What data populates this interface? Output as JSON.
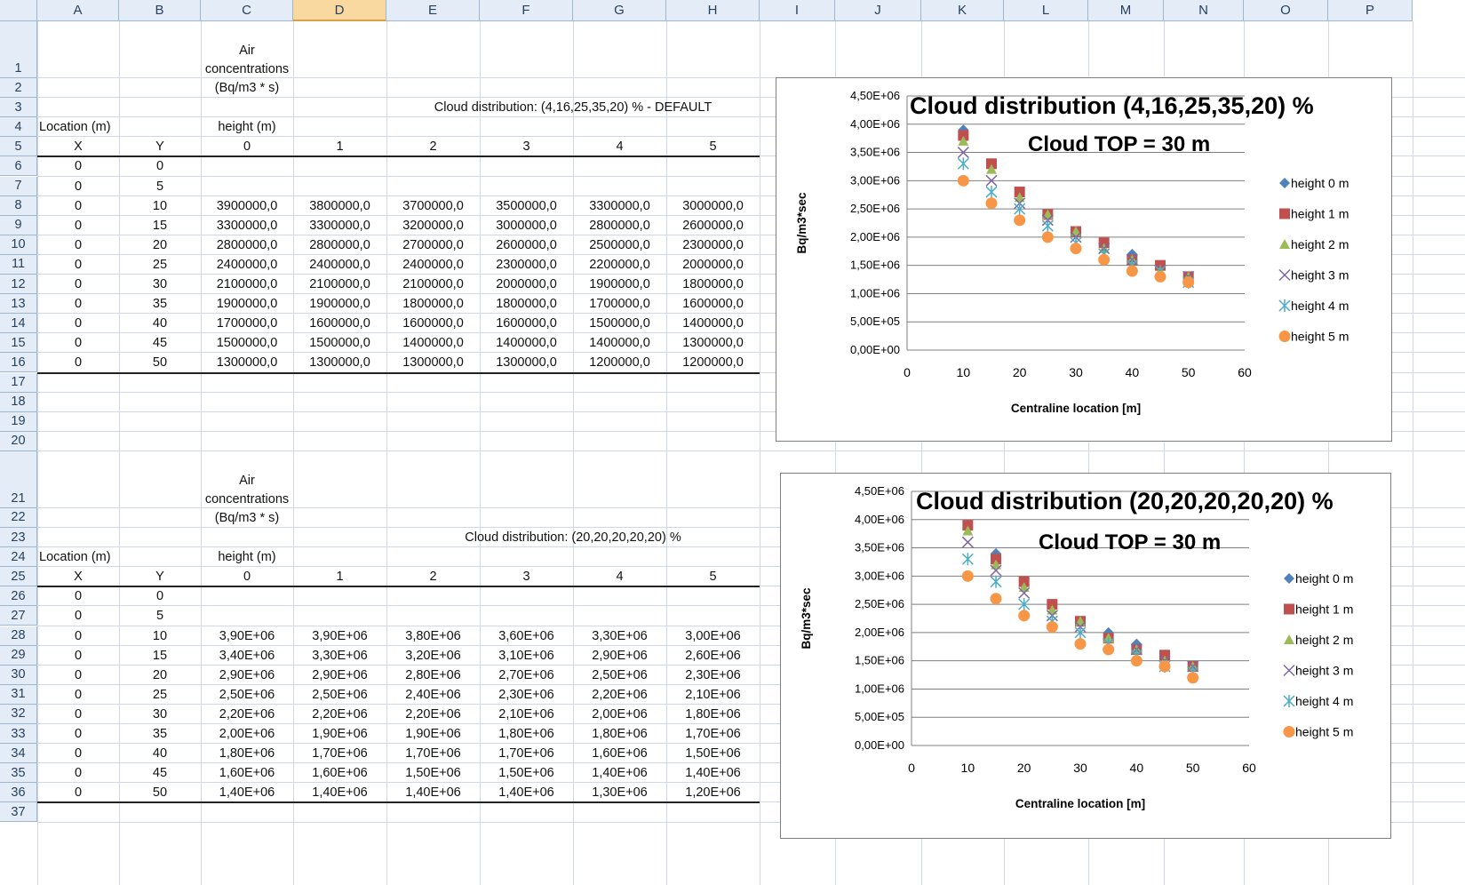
{
  "columns": [
    "A",
    "B",
    "C",
    "D",
    "E",
    "F",
    "G",
    "H",
    "I",
    "J",
    "K",
    "L",
    "M",
    "N",
    "O",
    "P"
  ],
  "selected_column": "D",
  "table1": {
    "header_label": "Air concentrations (Bq/m3 * s)",
    "title": "Cloud distribution:  (4,16,25,35,20) % - DEFAULT",
    "location_label": "Location (m)",
    "height_label": "height (m)",
    "x_label": "X",
    "y_label": "Y",
    "heights": [
      "0",
      "1",
      "2",
      "3",
      "4",
      "5"
    ],
    "rows": [
      {
        "x": "0",
        "y": "0",
        "vals": []
      },
      {
        "x": "0",
        "y": "5",
        "vals": []
      },
      {
        "x": "0",
        "y": "10",
        "vals": [
          "3900000,0",
          "3800000,0",
          "3700000,0",
          "3500000,0",
          "3300000,0",
          "3000000,0"
        ]
      },
      {
        "x": "0",
        "y": "15",
        "vals": [
          "3300000,0",
          "3300000,0",
          "3200000,0",
          "3000000,0",
          "2800000,0",
          "2600000,0"
        ]
      },
      {
        "x": "0",
        "y": "20",
        "vals": [
          "2800000,0",
          "2800000,0",
          "2700000,0",
          "2600000,0",
          "2500000,0",
          "2300000,0"
        ]
      },
      {
        "x": "0",
        "y": "25",
        "vals": [
          "2400000,0",
          "2400000,0",
          "2400000,0",
          "2300000,0",
          "2200000,0",
          "2000000,0"
        ]
      },
      {
        "x": "0",
        "y": "30",
        "vals": [
          "2100000,0",
          "2100000,0",
          "2100000,0",
          "2000000,0",
          "1900000,0",
          "1800000,0"
        ]
      },
      {
        "x": "0",
        "y": "35",
        "vals": [
          "1900000,0",
          "1900000,0",
          "1800000,0",
          "1800000,0",
          "1700000,0",
          "1600000,0"
        ]
      },
      {
        "x": "0",
        "y": "40",
        "vals": [
          "1700000,0",
          "1600000,0",
          "1600000,0",
          "1600000,0",
          "1500000,0",
          "1400000,0"
        ]
      },
      {
        "x": "0",
        "y": "45",
        "vals": [
          "1500000,0",
          "1500000,0",
          "1400000,0",
          "1400000,0",
          "1400000,0",
          "1300000,0"
        ]
      },
      {
        "x": "0",
        "y": "50",
        "vals": [
          "1300000,0",
          "1300000,0",
          "1300000,0",
          "1300000,0",
          "1200000,0",
          "1200000,0"
        ]
      }
    ]
  },
  "table2": {
    "header_label": "Air concentrations (Bq/m3 * s)",
    "title": "Cloud distribution:  (20,20,20,20,20) %",
    "location_label": "Location (m)",
    "height_label": "height (m)",
    "x_label": "X",
    "y_label": "Y",
    "heights": [
      "0",
      "1",
      "2",
      "3",
      "4",
      "5"
    ],
    "rows": [
      {
        "x": "0",
        "y": "0",
        "vals": []
      },
      {
        "x": "0",
        "y": "5",
        "vals": []
      },
      {
        "x": "0",
        "y": "10",
        "vals": [
          "3,90E+06",
          "3,90E+06",
          "3,80E+06",
          "3,60E+06",
          "3,30E+06",
          "3,00E+06"
        ]
      },
      {
        "x": "0",
        "y": "15",
        "vals": [
          "3,40E+06",
          "3,30E+06",
          "3,20E+06",
          "3,10E+06",
          "2,90E+06",
          "2,60E+06"
        ]
      },
      {
        "x": "0",
        "y": "20",
        "vals": [
          "2,90E+06",
          "2,90E+06",
          "2,80E+06",
          "2,70E+06",
          "2,50E+06",
          "2,30E+06"
        ]
      },
      {
        "x": "0",
        "y": "25",
        "vals": [
          "2,50E+06",
          "2,50E+06",
          "2,40E+06",
          "2,30E+06",
          "2,20E+06",
          "2,10E+06"
        ]
      },
      {
        "x": "0",
        "y": "30",
        "vals": [
          "2,20E+06",
          "2,20E+06",
          "2,20E+06",
          "2,10E+06",
          "2,00E+06",
          "1,80E+06"
        ]
      },
      {
        "x": "0",
        "y": "35",
        "vals": [
          "2,00E+06",
          "1,90E+06",
          "1,90E+06",
          "1,80E+06",
          "1,80E+06",
          "1,70E+06"
        ]
      },
      {
        "x": "0",
        "y": "40",
        "vals": [
          "1,80E+06",
          "1,70E+06",
          "1,70E+06",
          "1,70E+06",
          "1,60E+06",
          "1,50E+06"
        ]
      },
      {
        "x": "0",
        "y": "45",
        "vals": [
          "1,60E+06",
          "1,60E+06",
          "1,50E+06",
          "1,50E+06",
          "1,40E+06",
          "1,40E+06"
        ]
      },
      {
        "x": "0",
        "y": "50",
        "vals": [
          "1,40E+06",
          "1,40E+06",
          "1,40E+06",
          "1,40E+06",
          "1,30E+06",
          "1,20E+06"
        ]
      }
    ]
  },
  "chart_data": [
    {
      "type": "scatter",
      "title": "Cloud distribution (4,16,25,35,20) %",
      "subtitle": "Cloud TOP = 30 m",
      "xlabel": "Centraline location  [m]",
      "ylabel": "Bq/m3*sec",
      "xlim": [
        0,
        60
      ],
      "ylim": [
        0,
        4500000
      ],
      "x_ticks": [
        "0",
        "10",
        "20",
        "30",
        "40",
        "50",
        "60"
      ],
      "y_ticks": [
        "0,00E+00",
        "5,00E+05",
        "1,00E+06",
        "1,50E+06",
        "2,00E+06",
        "2,50E+06",
        "3,00E+06",
        "3,50E+06",
        "4,00E+06",
        "4,50E+06"
      ],
      "grid": true,
      "legend_position": "right",
      "x": [
        10,
        15,
        20,
        25,
        30,
        35,
        40,
        45,
        50
      ],
      "series": [
        {
          "name": "height 0 m",
          "color": "#4f81bd",
          "marker": "diamond",
          "values": [
            3900000,
            3300000,
            2800000,
            2400000,
            2100000,
            1900000,
            1700000,
            1500000,
            1300000
          ]
        },
        {
          "name": "height 1 m",
          "color": "#c0504d",
          "marker": "square",
          "values": [
            3800000,
            3300000,
            2800000,
            2400000,
            2100000,
            1900000,
            1600000,
            1500000,
            1300000
          ]
        },
        {
          "name": "height 2 m",
          "color": "#9bbb59",
          "marker": "triangle",
          "values": [
            3700000,
            3200000,
            2700000,
            2400000,
            2100000,
            1800000,
            1600000,
            1400000,
            1300000
          ]
        },
        {
          "name": "height 3 m",
          "color": "#8064a2",
          "marker": "x",
          "values": [
            3500000,
            3000000,
            2600000,
            2300000,
            2000000,
            1800000,
            1600000,
            1400000,
            1300000
          ]
        },
        {
          "name": "height 4 m",
          "color": "#4bacc6",
          "marker": "star",
          "values": [
            3300000,
            2800000,
            2500000,
            2200000,
            1900000,
            1700000,
            1500000,
            1400000,
            1200000
          ]
        },
        {
          "name": "height 5 m",
          "color": "#f79646",
          "marker": "circle",
          "values": [
            3000000,
            2600000,
            2300000,
            2000000,
            1800000,
            1600000,
            1400000,
            1300000,
            1200000
          ]
        }
      ]
    },
    {
      "type": "scatter",
      "title": "Cloud distribution (20,20,20,20,20) %",
      "subtitle": "Cloud TOP = 30 m",
      "xlabel": "Centraline location  [m]",
      "ylabel": "Bq/m3*sec",
      "xlim": [
        0,
        60
      ],
      "ylim": [
        0,
        4500000
      ],
      "x_ticks": [
        "0",
        "10",
        "20",
        "30",
        "40",
        "50",
        "60"
      ],
      "y_ticks": [
        "0,00E+00",
        "5,00E+05",
        "1,00E+06",
        "1,50E+06",
        "2,00E+06",
        "2,50E+06",
        "3,00E+06",
        "3,50E+06",
        "4,00E+06",
        "4,50E+06"
      ],
      "grid": true,
      "legend_position": "right",
      "x": [
        10,
        15,
        20,
        25,
        30,
        35,
        40,
        45,
        50
      ],
      "series": [
        {
          "name": "height 0 m",
          "color": "#4f81bd",
          "marker": "diamond",
          "values": [
            3900000,
            3400000,
            2900000,
            2500000,
            2200000,
            2000000,
            1800000,
            1600000,
            1400000
          ]
        },
        {
          "name": "height 1 m",
          "color": "#c0504d",
          "marker": "square",
          "values": [
            3900000,
            3300000,
            2900000,
            2500000,
            2200000,
            1900000,
            1700000,
            1600000,
            1400000
          ]
        },
        {
          "name": "height 2 m",
          "color": "#9bbb59",
          "marker": "triangle",
          "values": [
            3800000,
            3200000,
            2800000,
            2400000,
            2200000,
            1900000,
            1700000,
            1500000,
            1400000
          ]
        },
        {
          "name": "height 3 m",
          "color": "#8064a2",
          "marker": "x",
          "values": [
            3600000,
            3100000,
            2700000,
            2300000,
            2100000,
            1800000,
            1700000,
            1500000,
            1400000
          ]
        },
        {
          "name": "height 4 m",
          "color": "#4bacc6",
          "marker": "star",
          "values": [
            3300000,
            2900000,
            2500000,
            2200000,
            2000000,
            1800000,
            1600000,
            1400000,
            1300000
          ]
        },
        {
          "name": "height 5 m",
          "color": "#f79646",
          "marker": "circle",
          "values": [
            3000000,
            2600000,
            2300000,
            2100000,
            1800000,
            1700000,
            1500000,
            1400000,
            1200000
          ]
        }
      ]
    }
  ]
}
